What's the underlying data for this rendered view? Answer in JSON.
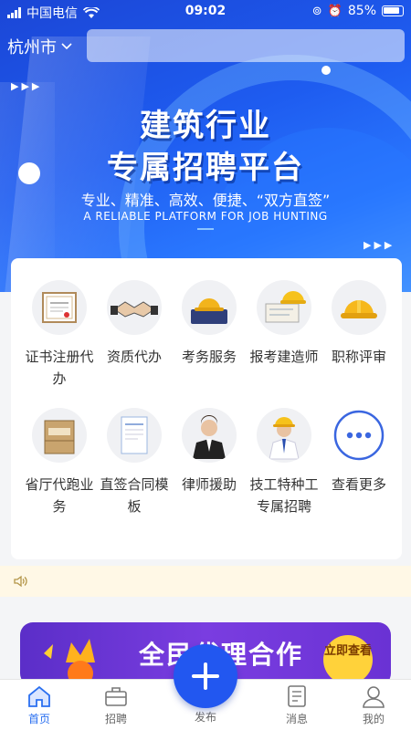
{
  "status_bar": {
    "carrier": "中国电信",
    "time": "09:02",
    "battery": "85%"
  },
  "header": {
    "city": "杭州市",
    "search_placeholder": ""
  },
  "banner": {
    "title_line1": "建筑行业",
    "title_line2": "专属招聘平台",
    "subtitle": "专业、精准、高效、便捷、“双方直签”",
    "tagline": "A RELIABLE PLATFORM FOR JOB HUNTING"
  },
  "services": [
    {
      "label": "证书注册代办",
      "icon": "certificate-icon"
    },
    {
      "label": "资质代办",
      "icon": "handshake-icon"
    },
    {
      "label": "考务服务",
      "icon": "hardhat-toolbox-icon"
    },
    {
      "label": "报考建造师",
      "icon": "blueprint-hardhat-icon"
    },
    {
      "label": "职称评审",
      "icon": "hardhat-icon"
    },
    {
      "label": "省厅代跑业务",
      "icon": "archive-box-icon"
    },
    {
      "label": "直签合同模板",
      "icon": "contract-document-icon"
    },
    {
      "label": "律师援助",
      "icon": "lawyer-icon"
    },
    {
      "label": "技工特种工专属招聘",
      "icon": "worker-icon"
    },
    {
      "label": "查看更多",
      "icon": "more-icon"
    }
  ],
  "promo": {
    "title": "全民代理合作",
    "button": "立即查看"
  },
  "tabbar": {
    "home": "首页",
    "jobs": "招聘",
    "publish": "发布",
    "messages": "消息",
    "mine": "我的"
  },
  "colors": {
    "primary": "#2257f0",
    "active_tab": "#2a6ff0",
    "notice_bg": "#fff8e6"
  }
}
